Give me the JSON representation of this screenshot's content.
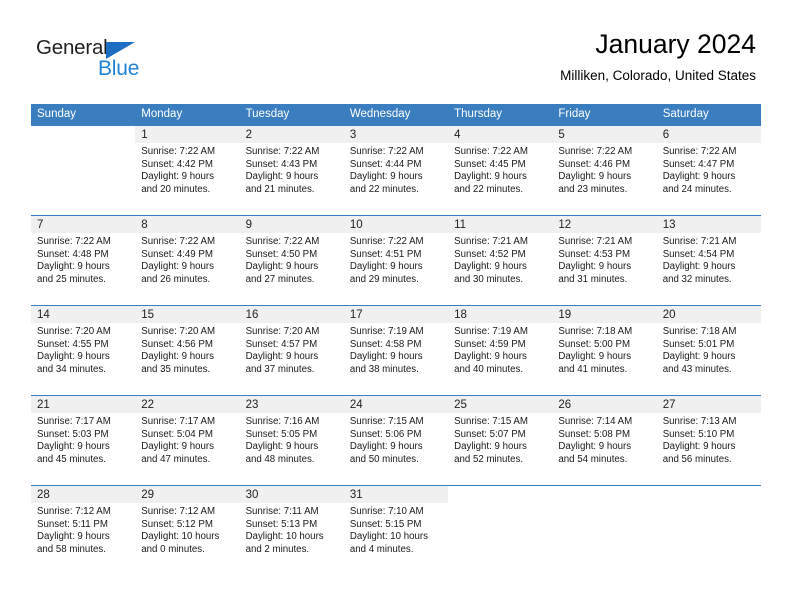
{
  "logo": {
    "text_primary": "General",
    "text_secondary": "Blue",
    "triangle_color": "#1b6ec2",
    "secondary_color": "#2183d4"
  },
  "header": {
    "title": "January 2024",
    "subtitle": "Milliken, Colorado, United States"
  },
  "theme": {
    "header_bg": "#3a7ebf",
    "header_text": "#ffffff",
    "daynum_band_bg": "#f0f0f0",
    "row_border": "#3a7ebf"
  },
  "weekday_headers": [
    "Sunday",
    "Monday",
    "Tuesday",
    "Wednesday",
    "Thursday",
    "Friday",
    "Saturday"
  ],
  "weeks": [
    [
      {
        "day": "",
        "lines": []
      },
      {
        "day": "1",
        "lines": [
          "Sunrise: 7:22 AM",
          "Sunset: 4:42 PM",
          "Daylight: 9 hours",
          "and 20 minutes."
        ]
      },
      {
        "day": "2",
        "lines": [
          "Sunrise: 7:22 AM",
          "Sunset: 4:43 PM",
          "Daylight: 9 hours",
          "and 21 minutes."
        ]
      },
      {
        "day": "3",
        "lines": [
          "Sunrise: 7:22 AM",
          "Sunset: 4:44 PM",
          "Daylight: 9 hours",
          "and 22 minutes."
        ]
      },
      {
        "day": "4",
        "lines": [
          "Sunrise: 7:22 AM",
          "Sunset: 4:45 PM",
          "Daylight: 9 hours",
          "and 22 minutes."
        ]
      },
      {
        "day": "5",
        "lines": [
          "Sunrise: 7:22 AM",
          "Sunset: 4:46 PM",
          "Daylight: 9 hours",
          "and 23 minutes."
        ]
      },
      {
        "day": "6",
        "lines": [
          "Sunrise: 7:22 AM",
          "Sunset: 4:47 PM",
          "Daylight: 9 hours",
          "and 24 minutes."
        ]
      }
    ],
    [
      {
        "day": "7",
        "lines": [
          "Sunrise: 7:22 AM",
          "Sunset: 4:48 PM",
          "Daylight: 9 hours",
          "and 25 minutes."
        ]
      },
      {
        "day": "8",
        "lines": [
          "Sunrise: 7:22 AM",
          "Sunset: 4:49 PM",
          "Daylight: 9 hours",
          "and 26 minutes."
        ]
      },
      {
        "day": "9",
        "lines": [
          "Sunrise: 7:22 AM",
          "Sunset: 4:50 PM",
          "Daylight: 9 hours",
          "and 27 minutes."
        ]
      },
      {
        "day": "10",
        "lines": [
          "Sunrise: 7:22 AM",
          "Sunset: 4:51 PM",
          "Daylight: 9 hours",
          "and 29 minutes."
        ]
      },
      {
        "day": "11",
        "lines": [
          "Sunrise: 7:21 AM",
          "Sunset: 4:52 PM",
          "Daylight: 9 hours",
          "and 30 minutes."
        ]
      },
      {
        "day": "12",
        "lines": [
          "Sunrise: 7:21 AM",
          "Sunset: 4:53 PM",
          "Daylight: 9 hours",
          "and 31 minutes."
        ]
      },
      {
        "day": "13",
        "lines": [
          "Sunrise: 7:21 AM",
          "Sunset: 4:54 PM",
          "Daylight: 9 hours",
          "and 32 minutes."
        ]
      }
    ],
    [
      {
        "day": "14",
        "lines": [
          "Sunrise: 7:20 AM",
          "Sunset: 4:55 PM",
          "Daylight: 9 hours",
          "and 34 minutes."
        ]
      },
      {
        "day": "15",
        "lines": [
          "Sunrise: 7:20 AM",
          "Sunset: 4:56 PM",
          "Daylight: 9 hours",
          "and 35 minutes."
        ]
      },
      {
        "day": "16",
        "lines": [
          "Sunrise: 7:20 AM",
          "Sunset: 4:57 PM",
          "Daylight: 9 hours",
          "and 37 minutes."
        ]
      },
      {
        "day": "17",
        "lines": [
          "Sunrise: 7:19 AM",
          "Sunset: 4:58 PM",
          "Daylight: 9 hours",
          "and 38 minutes."
        ]
      },
      {
        "day": "18",
        "lines": [
          "Sunrise: 7:19 AM",
          "Sunset: 4:59 PM",
          "Daylight: 9 hours",
          "and 40 minutes."
        ]
      },
      {
        "day": "19",
        "lines": [
          "Sunrise: 7:18 AM",
          "Sunset: 5:00 PM",
          "Daylight: 9 hours",
          "and 41 minutes."
        ]
      },
      {
        "day": "20",
        "lines": [
          "Sunrise: 7:18 AM",
          "Sunset: 5:01 PM",
          "Daylight: 9 hours",
          "and 43 minutes."
        ]
      }
    ],
    [
      {
        "day": "21",
        "lines": [
          "Sunrise: 7:17 AM",
          "Sunset: 5:03 PM",
          "Daylight: 9 hours",
          "and 45 minutes."
        ]
      },
      {
        "day": "22",
        "lines": [
          "Sunrise: 7:17 AM",
          "Sunset: 5:04 PM",
          "Daylight: 9 hours",
          "and 47 minutes."
        ]
      },
      {
        "day": "23",
        "lines": [
          "Sunrise: 7:16 AM",
          "Sunset: 5:05 PM",
          "Daylight: 9 hours",
          "and 48 minutes."
        ]
      },
      {
        "day": "24",
        "lines": [
          "Sunrise: 7:15 AM",
          "Sunset: 5:06 PM",
          "Daylight: 9 hours",
          "and 50 minutes."
        ]
      },
      {
        "day": "25",
        "lines": [
          "Sunrise: 7:15 AM",
          "Sunset: 5:07 PM",
          "Daylight: 9 hours",
          "and 52 minutes."
        ]
      },
      {
        "day": "26",
        "lines": [
          "Sunrise: 7:14 AM",
          "Sunset: 5:08 PM",
          "Daylight: 9 hours",
          "and 54 minutes."
        ]
      },
      {
        "day": "27",
        "lines": [
          "Sunrise: 7:13 AM",
          "Sunset: 5:10 PM",
          "Daylight: 9 hours",
          "and 56 minutes."
        ]
      }
    ],
    [
      {
        "day": "28",
        "lines": [
          "Sunrise: 7:12 AM",
          "Sunset: 5:11 PM",
          "Daylight: 9 hours",
          "and 58 minutes."
        ]
      },
      {
        "day": "29",
        "lines": [
          "Sunrise: 7:12 AM",
          "Sunset: 5:12 PM",
          "Daylight: 10 hours",
          "and 0 minutes."
        ]
      },
      {
        "day": "30",
        "lines": [
          "Sunrise: 7:11 AM",
          "Sunset: 5:13 PM",
          "Daylight: 10 hours",
          "and 2 minutes."
        ]
      },
      {
        "day": "31",
        "lines": [
          "Sunrise: 7:10 AM",
          "Sunset: 5:15 PM",
          "Daylight: 10 hours",
          "and 4 minutes."
        ]
      },
      {
        "day": "",
        "lines": []
      },
      {
        "day": "",
        "lines": []
      },
      {
        "day": "",
        "lines": []
      }
    ]
  ]
}
